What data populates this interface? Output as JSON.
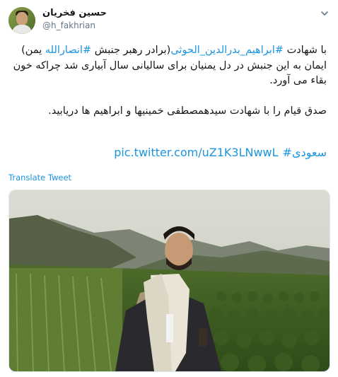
{
  "tweet": {
    "author_name": "حسین فخریان",
    "author_handle": "@h_fakhrian",
    "text": {
      "line1_before": "با شهادت ",
      "hashtag1": "#ابراهیم_بدرالدین_الحوثی",
      "line1_mid": "(برادر رهبر جنبش ",
      "hashtag2": "#انصارالله",
      "line2": " یمن) ایمان به این جنبش در دل یمنیان برای سالیانی سال آبیاری شد چراکه خون بقاء می آورد.",
      "paragraph2": "صدق قیام را با شهادت سیدهمصطفی خمینیها و ابراهیم ها دریابید."
    },
    "hashtag3": "#سعودی",
    "media_link": "pic.twitter.com/uZ1K3LNwwL",
    "translate_label": "Translate Tweet",
    "icons": {
      "more": "chevron-down-icon"
    }
  }
}
